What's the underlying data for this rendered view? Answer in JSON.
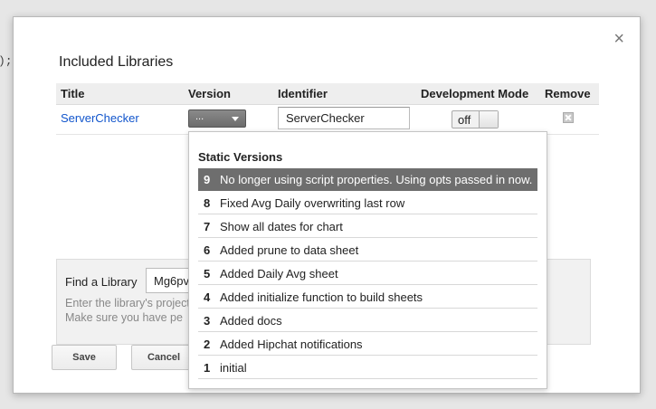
{
  "background": {
    "code_fragment": ");"
  },
  "dialog": {
    "title": "Included Libraries",
    "close_icon": "×",
    "table": {
      "headers": {
        "title": "Title",
        "version": "Version",
        "identifier": "Identifier",
        "dev_mode": "Development Mode",
        "remove": "Remove"
      },
      "row": {
        "title": "ServerChecker",
        "version": "...",
        "identifier": "ServerChecker",
        "dev_mode": "off"
      }
    },
    "find": {
      "label": "Find a Library",
      "value": "Mg6pv",
      "help_line1": "Enter the library's project",
      "help_line2": "Make sure you have pe"
    },
    "buttons": {
      "save": "Save",
      "cancel": "Cancel"
    }
  },
  "dropdown": {
    "header": "Static Versions",
    "selected_index": 0,
    "items": [
      {
        "num": "9",
        "text": "No longer using script properties. Using opts passed in now."
      },
      {
        "num": "8",
        "text": "Fixed Avg Daily overwriting last row"
      },
      {
        "num": "7",
        "text": "Show all dates for chart"
      },
      {
        "num": "6",
        "text": "Added prune to data sheet"
      },
      {
        "num": "5",
        "text": "Added Daily Avg sheet"
      },
      {
        "num": "4",
        "text": "Added initialize function to build sheets"
      },
      {
        "num": "3",
        "text": "Added docs"
      },
      {
        "num": "2",
        "text": "Added Hipchat notifications"
      },
      {
        "num": "1",
        "text": "initial"
      }
    ]
  }
}
